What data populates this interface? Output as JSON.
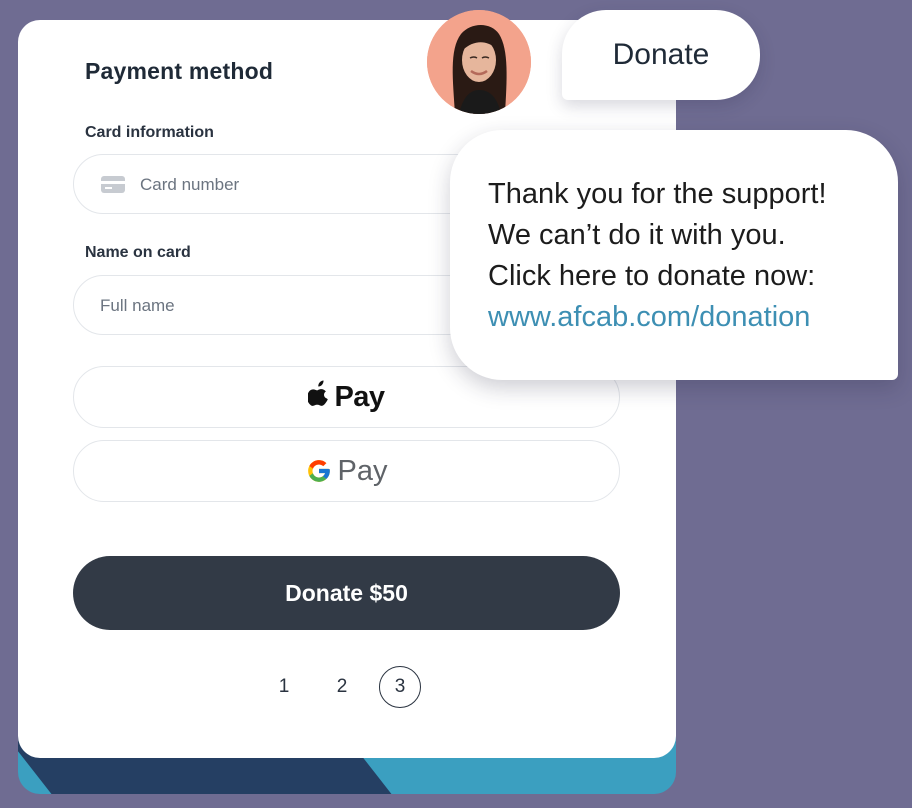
{
  "payment": {
    "title": "Payment method",
    "card_label": "Card information",
    "card_placeholder": "Card number",
    "name_label": "Name on card",
    "name_placeholder": "Full name",
    "apple_pay_label": "Pay",
    "google_pay_label": "Pay",
    "donate_button": "Donate $50",
    "pages": [
      "1",
      "2",
      "3"
    ],
    "active_page": "3"
  },
  "chat": {
    "donate_bubble": "Donate",
    "message_lines": [
      "Thank you for the support!",
      "We can’t do it with you.",
      "Click here to donate now:"
    ],
    "link_text": "www.afcab.com/donation"
  },
  "colors": {
    "background": "#6f6c92",
    "button_dark": "#323a46",
    "link": "#3d8fb3",
    "avatar_bg": "#f3a38c"
  },
  "icons": [
    "card-icon",
    "apple-logo-icon",
    "google-g-icon"
  ]
}
